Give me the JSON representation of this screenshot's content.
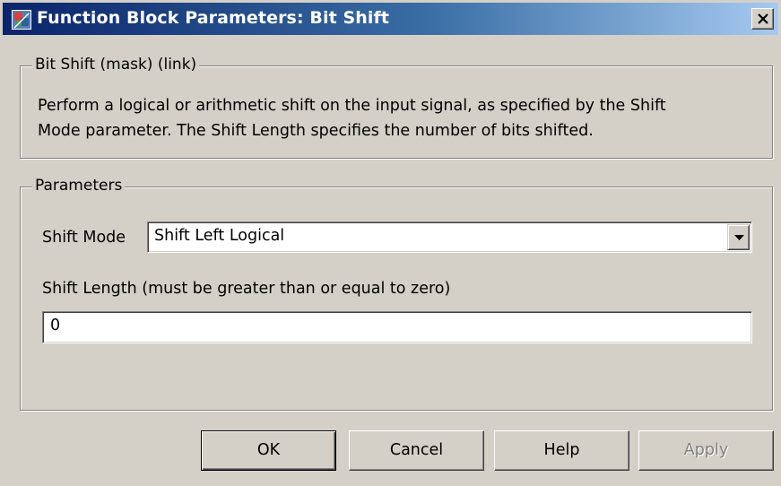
{
  "window": {
    "title": "Function Block Parameters: Bit Shift",
    "app_icon": "simulink-block-icon",
    "close_icon": "close-icon"
  },
  "description_group": {
    "legend": "Bit Shift (mask) (link)",
    "line1": "Perform a logical or arithmetic shift on the input signal, as specified by the Shift",
    "line2": "Mode parameter. The Shift Length specifies the number of bits shifted."
  },
  "parameters_group": {
    "legend": "Parameters",
    "shift_mode": {
      "label": "Shift Mode",
      "selected": "Shift Left Logical",
      "icon": "chevron-down-icon"
    },
    "shift_length": {
      "label": "Shift Length (must be greater than or equal to zero)",
      "value": "0"
    }
  },
  "buttons": {
    "ok": "OK",
    "cancel": "Cancel",
    "help": "Help",
    "apply": "Apply"
  },
  "colors": {
    "title_bar_start": "#0a246a",
    "title_bar_end": "#a6caf0",
    "dialog_face": "#d4d0c8",
    "disabled_text": "#808080"
  }
}
